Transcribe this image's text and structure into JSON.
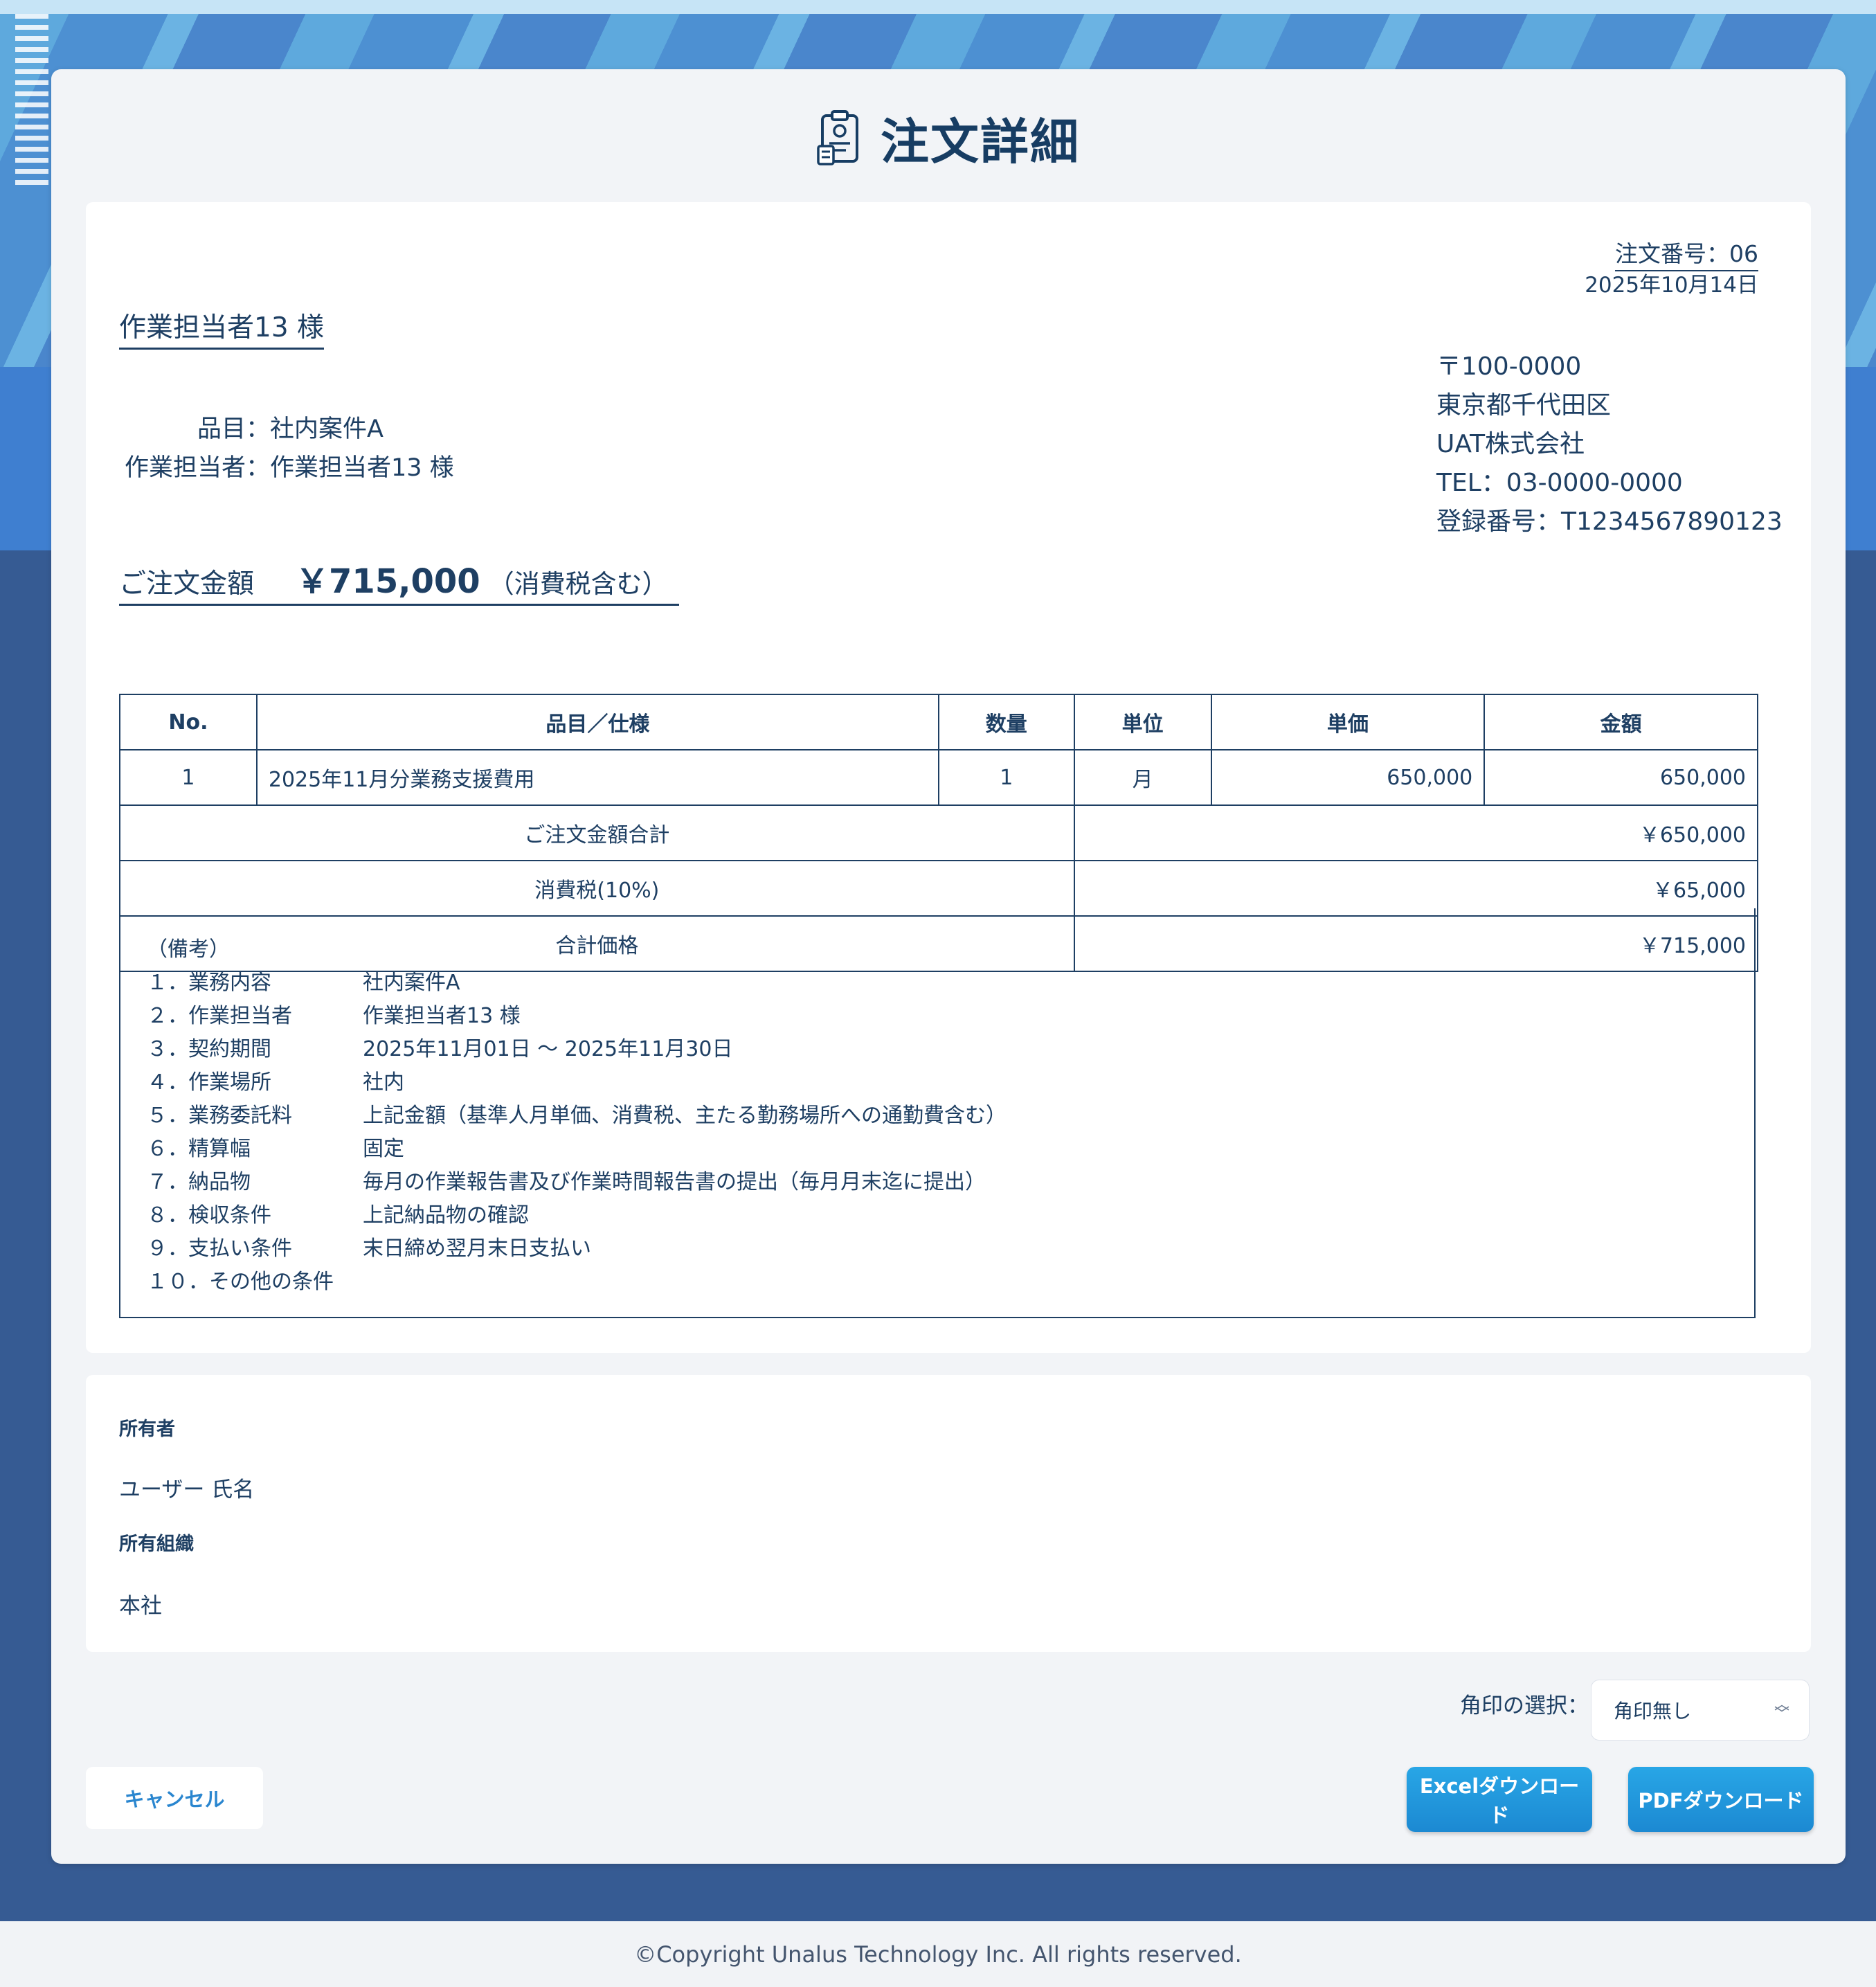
{
  "header": {
    "title": "注文詳細",
    "icon": "clipboard-document-icon"
  },
  "document": {
    "order_no": "注文番号：06",
    "date": "2025年10月14日",
    "recipient": "作業担当者13 様",
    "item_label": "品目：",
    "item_value": "社内案件A",
    "worker_label": "作業担当者：",
    "worker_value": "作業担当者13 様",
    "sender": {
      "postal": "〒100-0000",
      "address": "東京都千代田区",
      "company": "UAT株式会社",
      "tel": "TEL：03-0000-0000",
      "reg_no": "登録番号：T1234567890123"
    },
    "amount_label": "ご注文金額",
    "amount_value": "￥715,000",
    "amount_note": "（消費税含む）"
  },
  "table": {
    "headers": [
      "No.",
      "品目／仕様",
      "数量",
      "単位",
      "単価",
      "金額"
    ],
    "rows": [
      {
        "no": "1",
        "item": "2025年11月分業務支援費用",
        "qty": "1",
        "unit": "月",
        "unit_price": "650,000",
        "amount": "650,000"
      }
    ],
    "subtotal_label": "ご注文金額合計",
    "subtotal_value": "￥650,000",
    "tax_label": "消費税(10%)",
    "tax_value": "￥65,000",
    "total_label": "合計価格",
    "total_value": "￥715,000"
  },
  "remarks": {
    "title": "（備考）",
    "items": [
      {
        "key": "１．業務内容",
        "value": "社内案件A"
      },
      {
        "key": "２．作業担当者",
        "value": "作業担当者13 様"
      },
      {
        "key": "３．契約期間",
        "value": "2025年11月01日 ～ 2025年11月30日"
      },
      {
        "key": "４．作業場所",
        "value": "社内"
      },
      {
        "key": "５．業務委託料",
        "value": "上記金額（基準人月単価、消費税、主たる勤務場所への通勤費含む）"
      },
      {
        "key": "６．精算幅",
        "value": "固定"
      },
      {
        "key": "７．納品物",
        "value": "毎月の作業報告書及び作業時間報告書の提出（毎月月末迄に提出）"
      },
      {
        "key": "８．検収条件",
        "value": "上記納品物の確認"
      },
      {
        "key": "９．支払い条件",
        "value": "末日締め翌月末日支払い"
      },
      {
        "key": "１０．その他の条件",
        "value": ""
      }
    ]
  },
  "owner": {
    "owner_label": "所有者",
    "owner_value": "ユーザー 氏名",
    "org_label": "所有組織",
    "org_value": "本社"
  },
  "controls": {
    "stamp_label": "角印の選択：",
    "stamp_selected": "角印無し",
    "cancel": "キャンセル",
    "excel": "Excelダウンロード",
    "pdf": "PDFダウンロード"
  },
  "footer": {
    "copyright": "©Copyright Unalus Technology Inc. All rights reserved."
  },
  "colors": {
    "primary_text": "#1e3f63",
    "button_blue": "#1c89d2",
    "background_navy": "#365b93"
  }
}
